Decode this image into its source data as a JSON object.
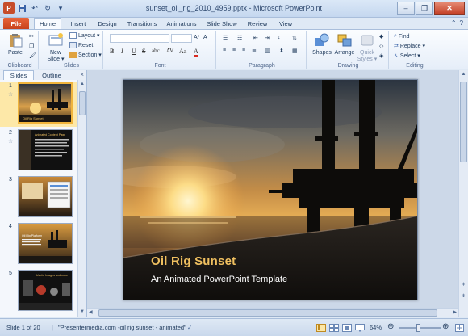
{
  "titlebar": {
    "title": "sunset_oil_rig_2010_4959.pptx - Microsoft PowerPoint",
    "app_icon": "P",
    "minimize": "–",
    "restore": "❐",
    "close": "✕"
  },
  "tabs": {
    "file": "File",
    "items": [
      "Home",
      "Insert",
      "Design",
      "Transitions",
      "Animations",
      "Slide Show",
      "Review",
      "View"
    ],
    "active": "Home",
    "help": "?"
  },
  "ribbon": {
    "clipboard": {
      "paste": "Paste",
      "label": "Clipboard"
    },
    "slides": {
      "new_slide_line1": "New",
      "new_slide_line2": "Slide ▾",
      "layout": "Layout ▾",
      "reset": "Reset",
      "section": "Section ▾",
      "label": "Slides"
    },
    "font": {
      "bold": "B",
      "italic": "I",
      "underline": "U",
      "strike": "S",
      "shadow": "abc",
      "spacing": "AV",
      "case": "Aa",
      "color": "A",
      "label": "Font"
    },
    "paragraph": {
      "label": "Paragraph"
    },
    "drawing": {
      "shapes": "Shapes",
      "arrange": "Arrange",
      "quick_styles_line1": "Quick",
      "quick_styles_line2": "Styles ▾",
      "label": "Drawing"
    },
    "editing": {
      "find": "Find",
      "replace": "Replace ▾",
      "select": "Select ▾",
      "label": "Editing"
    }
  },
  "left_panel": {
    "tab_slides": "Slides",
    "tab_outline": "Outline",
    "close": "×",
    "thumbnails": [
      {
        "num": "1",
        "selected": true,
        "title": "Oil Rig Sunset"
      },
      {
        "num": "2",
        "selected": false,
        "title": "Animated Content Page"
      },
      {
        "num": "3",
        "selected": false,
        "title": ""
      },
      {
        "num": "4",
        "selected": false,
        "title": "Oil Rig Platform"
      },
      {
        "num": "5",
        "selected": false,
        "title": "Useful Images and more"
      }
    ]
  },
  "slide": {
    "title": "Oil Rig Sunset",
    "subtitle": "An Animated  PowerPoint Template"
  },
  "statusbar": {
    "slide_info": "Slide 1 of 20",
    "theme": "\"Presentermedia.com -oil rig sunset - animated\"",
    "zoom": "64%"
  },
  "colors": {
    "accent_file": "#c8431d",
    "title_gold": "#f0c060",
    "thumb_selected": "#f0b43c"
  }
}
